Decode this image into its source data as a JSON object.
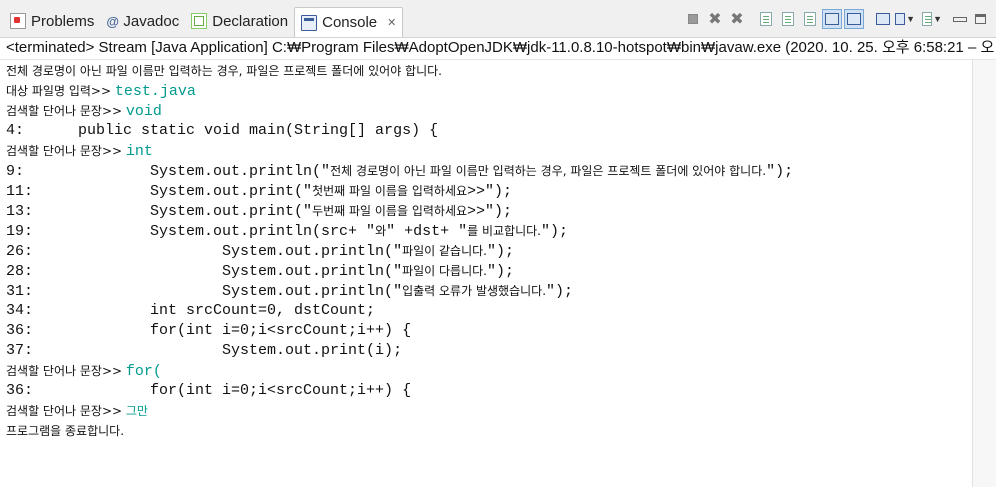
{
  "tabs": [
    {
      "label": "Problems",
      "icon": "problems-icon"
    },
    {
      "label": "Javadoc",
      "icon": "javadoc-icon"
    },
    {
      "label": "Declaration",
      "icon": "declaration-icon"
    },
    {
      "label": "Console",
      "icon": "console-icon",
      "active": true
    }
  ],
  "tab_close_glyph": "✕",
  "status_line": "<terminated> Stream [Java Application] C:₩Program Files₩AdoptOpenJDK₩jdk-11.0.8.10-hotspot₩bin₩javaw.exe  (2020. 10. 25. 오후 6:58:21 – 오",
  "colors": {
    "input_text": "#009a8e",
    "active_tab_bg": "#ffffff",
    "tabbar_bg": "#f0f0f0"
  },
  "console": {
    "l01": "전체 경로명이 아닌 파일 이름만 입력하는 경우, 파일은 프로젝트 폴더에 있어야 합니다.",
    "l02_prompt": "대상 파일명 입력>> ",
    "l02_input": "test.java",
    "l03_prompt": "검색할 단어나 문장>> ",
    "l03_input": "void",
    "l04": "4:      public static void main(String[] args) {",
    "l05_prompt": "검색할 단어나 문장>> ",
    "l05_input": "int",
    "l06a": "9:              System.out.println(\"",
    "l06b": "전체 경로명이 아닌 파일 이름만 입력하는 경우, 파일은 프로젝트 폴더에 있어야 합니다.",
    "l06c": "\");",
    "l07a": "11:             System.out.print(\"",
    "l07b": "첫번째 파일 이름을 입력하세요",
    "l07c": ">>\");",
    "l08a": "13:             System.out.print(\"",
    "l08b": "두번째 파일 이름을 입력하세요",
    "l08c": ">>\");",
    "l09a": "19:             System.out.println(src+ \"",
    "l09b": "와",
    "l09c": "\" +dst+ \"",
    "l09d": "를 비교합니다.",
    "l09e": "\");",
    "l10a": "26:                     System.out.println(\"",
    "l10b": "파일이 같습니다.",
    "l10c": "\");",
    "l11a": "28:                     System.out.println(\"",
    "l11b": "파일이 다릅니다.",
    "l11c": "\");",
    "l12a": "31:                     System.out.println(\"",
    "l12b": "입출력 오류가 발생했습니다.",
    "l12c": "\");",
    "l13": "34:             int srcCount=0, dstCount;",
    "l14": "36:             for(int i=0;i<srcCount;i++) {",
    "l15": "37:                     System.out.print(i);",
    "l16_prompt": "검색할 단어나 문장>> ",
    "l16_input": "for(",
    "l17": "36:             for(int i=0;i<srcCount;i++) {",
    "l18_prompt": "검색할 단어나 문장>> ",
    "l18_input": "그만",
    "l19": "프로그램을 종료합니다."
  }
}
